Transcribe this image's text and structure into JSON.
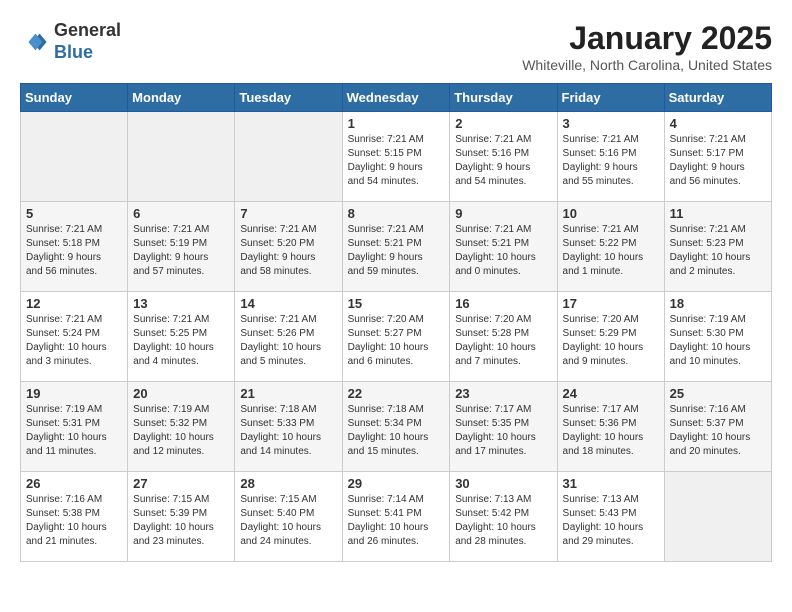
{
  "logo": {
    "general": "General",
    "blue": "Blue"
  },
  "header": {
    "month": "January 2025",
    "location": "Whiteville, North Carolina, United States"
  },
  "weekdays": [
    "Sunday",
    "Monday",
    "Tuesday",
    "Wednesday",
    "Thursday",
    "Friday",
    "Saturday"
  ],
  "weeks": [
    [
      {
        "day": "",
        "info": ""
      },
      {
        "day": "",
        "info": ""
      },
      {
        "day": "",
        "info": ""
      },
      {
        "day": "1",
        "info": "Sunrise: 7:21 AM\nSunset: 5:15 PM\nDaylight: 9 hours\nand 54 minutes."
      },
      {
        "day": "2",
        "info": "Sunrise: 7:21 AM\nSunset: 5:16 PM\nDaylight: 9 hours\nand 54 minutes."
      },
      {
        "day": "3",
        "info": "Sunrise: 7:21 AM\nSunset: 5:16 PM\nDaylight: 9 hours\nand 55 minutes."
      },
      {
        "day": "4",
        "info": "Sunrise: 7:21 AM\nSunset: 5:17 PM\nDaylight: 9 hours\nand 56 minutes."
      }
    ],
    [
      {
        "day": "5",
        "info": "Sunrise: 7:21 AM\nSunset: 5:18 PM\nDaylight: 9 hours\nand 56 minutes."
      },
      {
        "day": "6",
        "info": "Sunrise: 7:21 AM\nSunset: 5:19 PM\nDaylight: 9 hours\nand 57 minutes."
      },
      {
        "day": "7",
        "info": "Sunrise: 7:21 AM\nSunset: 5:20 PM\nDaylight: 9 hours\nand 58 minutes."
      },
      {
        "day": "8",
        "info": "Sunrise: 7:21 AM\nSunset: 5:21 PM\nDaylight: 9 hours\nand 59 minutes."
      },
      {
        "day": "9",
        "info": "Sunrise: 7:21 AM\nSunset: 5:21 PM\nDaylight: 10 hours\nand 0 minutes."
      },
      {
        "day": "10",
        "info": "Sunrise: 7:21 AM\nSunset: 5:22 PM\nDaylight: 10 hours\nand 1 minute."
      },
      {
        "day": "11",
        "info": "Sunrise: 7:21 AM\nSunset: 5:23 PM\nDaylight: 10 hours\nand 2 minutes."
      }
    ],
    [
      {
        "day": "12",
        "info": "Sunrise: 7:21 AM\nSunset: 5:24 PM\nDaylight: 10 hours\nand 3 minutes."
      },
      {
        "day": "13",
        "info": "Sunrise: 7:21 AM\nSunset: 5:25 PM\nDaylight: 10 hours\nand 4 minutes."
      },
      {
        "day": "14",
        "info": "Sunrise: 7:21 AM\nSunset: 5:26 PM\nDaylight: 10 hours\nand 5 minutes."
      },
      {
        "day": "15",
        "info": "Sunrise: 7:20 AM\nSunset: 5:27 PM\nDaylight: 10 hours\nand 6 minutes."
      },
      {
        "day": "16",
        "info": "Sunrise: 7:20 AM\nSunset: 5:28 PM\nDaylight: 10 hours\nand 7 minutes."
      },
      {
        "day": "17",
        "info": "Sunrise: 7:20 AM\nSunset: 5:29 PM\nDaylight: 10 hours\nand 9 minutes."
      },
      {
        "day": "18",
        "info": "Sunrise: 7:19 AM\nSunset: 5:30 PM\nDaylight: 10 hours\nand 10 minutes."
      }
    ],
    [
      {
        "day": "19",
        "info": "Sunrise: 7:19 AM\nSunset: 5:31 PM\nDaylight: 10 hours\nand 11 minutes."
      },
      {
        "day": "20",
        "info": "Sunrise: 7:19 AM\nSunset: 5:32 PM\nDaylight: 10 hours\nand 12 minutes."
      },
      {
        "day": "21",
        "info": "Sunrise: 7:18 AM\nSunset: 5:33 PM\nDaylight: 10 hours\nand 14 minutes."
      },
      {
        "day": "22",
        "info": "Sunrise: 7:18 AM\nSunset: 5:34 PM\nDaylight: 10 hours\nand 15 minutes."
      },
      {
        "day": "23",
        "info": "Sunrise: 7:17 AM\nSunset: 5:35 PM\nDaylight: 10 hours\nand 17 minutes."
      },
      {
        "day": "24",
        "info": "Sunrise: 7:17 AM\nSunset: 5:36 PM\nDaylight: 10 hours\nand 18 minutes."
      },
      {
        "day": "25",
        "info": "Sunrise: 7:16 AM\nSunset: 5:37 PM\nDaylight: 10 hours\nand 20 minutes."
      }
    ],
    [
      {
        "day": "26",
        "info": "Sunrise: 7:16 AM\nSunset: 5:38 PM\nDaylight: 10 hours\nand 21 minutes."
      },
      {
        "day": "27",
        "info": "Sunrise: 7:15 AM\nSunset: 5:39 PM\nDaylight: 10 hours\nand 23 minutes."
      },
      {
        "day": "28",
        "info": "Sunrise: 7:15 AM\nSunset: 5:40 PM\nDaylight: 10 hours\nand 24 minutes."
      },
      {
        "day": "29",
        "info": "Sunrise: 7:14 AM\nSunset: 5:41 PM\nDaylight: 10 hours\nand 26 minutes."
      },
      {
        "day": "30",
        "info": "Sunrise: 7:13 AM\nSunset: 5:42 PM\nDaylight: 10 hours\nand 28 minutes."
      },
      {
        "day": "31",
        "info": "Sunrise: 7:13 AM\nSunset: 5:43 PM\nDaylight: 10 hours\nand 29 minutes."
      },
      {
        "day": "",
        "info": ""
      }
    ]
  ],
  "colors": {
    "header_bg": "#2e6da4",
    "header_text": "#ffffff",
    "accent_blue": "#2e6da4"
  }
}
